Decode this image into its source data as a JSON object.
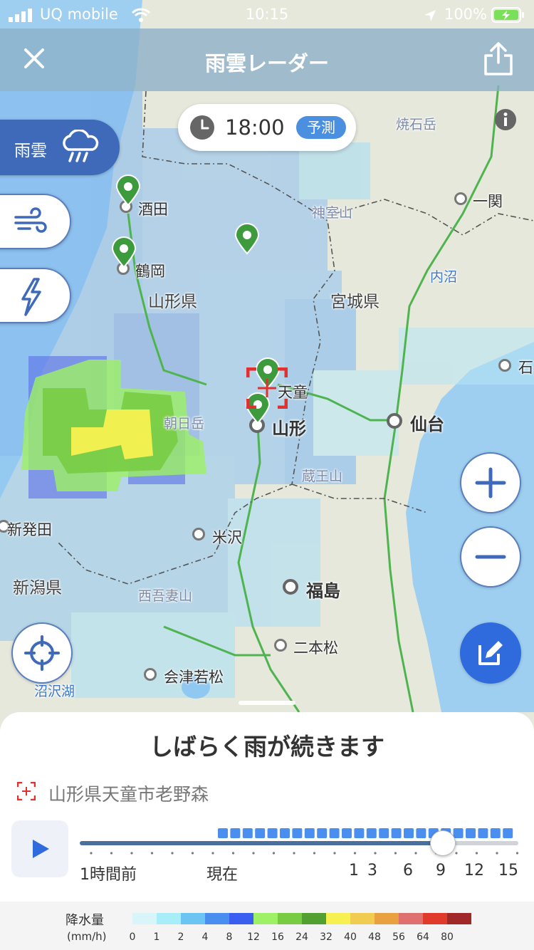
{
  "status_bar": {
    "carrier": "UQ mobile",
    "time": "10:15",
    "battery": "100%"
  },
  "header": {
    "title": "雨雲レーダー"
  },
  "time_pill": {
    "time": "18:00",
    "badge": "予測"
  },
  "layers": {
    "rain_label": "雨雲",
    "rain_icon": "rain-cloud-icon",
    "wind_icon": "wind-icon",
    "thunder_icon": "lightning-icon"
  },
  "map_labels": {
    "sakata": "酒田",
    "tsuruoka": "鶴岡",
    "yamagata_pref": "山形県",
    "miyagi_pref": "宮城県",
    "niigata_pref": "新潟県",
    "tendo": "天童",
    "yamagata": "山形",
    "sendai": "仙台",
    "ichinoseki": "一関",
    "ishi": "石",
    "kamimuro": "神室山",
    "yakeishi": "焼石岳",
    "uchinuma": "内沼",
    "asahi": "朝日岳",
    "zao": "蔵王山",
    "shibata": "新発田",
    "yonezawa": "米沢",
    "fukushima": "福島",
    "nishiazuma": "西吾妻山",
    "nihonmatsu": "二本松",
    "aizuwakamatsu": "会津若松",
    "numazawa": "沼沢湖"
  },
  "sheet": {
    "headline": "しばらく雨が続きます",
    "location": "山形県天童市老野森"
  },
  "timeline": {
    "current_fraction": 0.828,
    "labels": [
      "1時間前",
      "現在",
      "1",
      "3",
      "6",
      "9",
      "12",
      "15"
    ]
  },
  "legend": {
    "title": "降水量",
    "unit": "(mm/h)",
    "values": [
      "0",
      "1",
      "2",
      "4",
      "8",
      "12",
      "16",
      "24",
      "32",
      "40",
      "48",
      "56",
      "64",
      "80"
    ],
    "colors": [
      "#d8f6fa",
      "#a8eef8",
      "#6cc4f2",
      "#4a8ff0",
      "#3a5ff0",
      "#9ef064",
      "#78cc44",
      "#52a032",
      "#f6f050",
      "#f0cc50",
      "#e8a040",
      "#e07070",
      "#e03a2a",
      "#a02828"
    ]
  },
  "colors": {
    "accent": "#2f6bdd",
    "tab_active": "#3e6ab9",
    "pin": "#3d9a3d"
  }
}
